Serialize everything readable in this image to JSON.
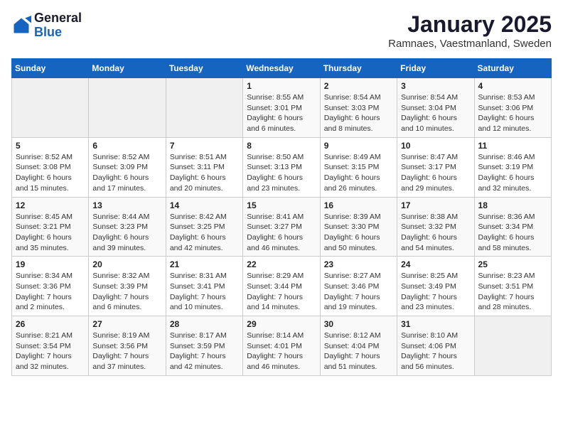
{
  "header": {
    "logo_general": "General",
    "logo_blue": "Blue",
    "month": "January 2025",
    "location": "Ramnaes, Vaestmanland, Sweden"
  },
  "days_of_week": [
    "Sunday",
    "Monday",
    "Tuesday",
    "Wednesday",
    "Thursday",
    "Friday",
    "Saturday"
  ],
  "weeks": [
    [
      {
        "day": "",
        "info": ""
      },
      {
        "day": "",
        "info": ""
      },
      {
        "day": "",
        "info": ""
      },
      {
        "day": "1",
        "info": "Sunrise: 8:55 AM\nSunset: 3:01 PM\nDaylight: 6 hours\nand 6 minutes."
      },
      {
        "day": "2",
        "info": "Sunrise: 8:54 AM\nSunset: 3:03 PM\nDaylight: 6 hours\nand 8 minutes."
      },
      {
        "day": "3",
        "info": "Sunrise: 8:54 AM\nSunset: 3:04 PM\nDaylight: 6 hours\nand 10 minutes."
      },
      {
        "day": "4",
        "info": "Sunrise: 8:53 AM\nSunset: 3:06 PM\nDaylight: 6 hours\nand 12 minutes."
      }
    ],
    [
      {
        "day": "5",
        "info": "Sunrise: 8:52 AM\nSunset: 3:08 PM\nDaylight: 6 hours\nand 15 minutes."
      },
      {
        "day": "6",
        "info": "Sunrise: 8:52 AM\nSunset: 3:09 PM\nDaylight: 6 hours\nand 17 minutes."
      },
      {
        "day": "7",
        "info": "Sunrise: 8:51 AM\nSunset: 3:11 PM\nDaylight: 6 hours\nand 20 minutes."
      },
      {
        "day": "8",
        "info": "Sunrise: 8:50 AM\nSunset: 3:13 PM\nDaylight: 6 hours\nand 23 minutes."
      },
      {
        "day": "9",
        "info": "Sunrise: 8:49 AM\nSunset: 3:15 PM\nDaylight: 6 hours\nand 26 minutes."
      },
      {
        "day": "10",
        "info": "Sunrise: 8:47 AM\nSunset: 3:17 PM\nDaylight: 6 hours\nand 29 minutes."
      },
      {
        "day": "11",
        "info": "Sunrise: 8:46 AM\nSunset: 3:19 PM\nDaylight: 6 hours\nand 32 minutes."
      }
    ],
    [
      {
        "day": "12",
        "info": "Sunrise: 8:45 AM\nSunset: 3:21 PM\nDaylight: 6 hours\nand 35 minutes."
      },
      {
        "day": "13",
        "info": "Sunrise: 8:44 AM\nSunset: 3:23 PM\nDaylight: 6 hours\nand 39 minutes."
      },
      {
        "day": "14",
        "info": "Sunrise: 8:42 AM\nSunset: 3:25 PM\nDaylight: 6 hours\nand 42 minutes."
      },
      {
        "day": "15",
        "info": "Sunrise: 8:41 AM\nSunset: 3:27 PM\nDaylight: 6 hours\nand 46 minutes."
      },
      {
        "day": "16",
        "info": "Sunrise: 8:39 AM\nSunset: 3:30 PM\nDaylight: 6 hours\nand 50 minutes."
      },
      {
        "day": "17",
        "info": "Sunrise: 8:38 AM\nSunset: 3:32 PM\nDaylight: 6 hours\nand 54 minutes."
      },
      {
        "day": "18",
        "info": "Sunrise: 8:36 AM\nSunset: 3:34 PM\nDaylight: 6 hours\nand 58 minutes."
      }
    ],
    [
      {
        "day": "19",
        "info": "Sunrise: 8:34 AM\nSunset: 3:36 PM\nDaylight: 7 hours\nand 2 minutes."
      },
      {
        "day": "20",
        "info": "Sunrise: 8:32 AM\nSunset: 3:39 PM\nDaylight: 7 hours\nand 6 minutes."
      },
      {
        "day": "21",
        "info": "Sunrise: 8:31 AM\nSunset: 3:41 PM\nDaylight: 7 hours\nand 10 minutes."
      },
      {
        "day": "22",
        "info": "Sunrise: 8:29 AM\nSunset: 3:44 PM\nDaylight: 7 hours\nand 14 minutes."
      },
      {
        "day": "23",
        "info": "Sunrise: 8:27 AM\nSunset: 3:46 PM\nDaylight: 7 hours\nand 19 minutes."
      },
      {
        "day": "24",
        "info": "Sunrise: 8:25 AM\nSunset: 3:49 PM\nDaylight: 7 hours\nand 23 minutes."
      },
      {
        "day": "25",
        "info": "Sunrise: 8:23 AM\nSunset: 3:51 PM\nDaylight: 7 hours\nand 28 minutes."
      }
    ],
    [
      {
        "day": "26",
        "info": "Sunrise: 8:21 AM\nSunset: 3:54 PM\nDaylight: 7 hours\nand 32 minutes."
      },
      {
        "day": "27",
        "info": "Sunrise: 8:19 AM\nSunset: 3:56 PM\nDaylight: 7 hours\nand 37 minutes."
      },
      {
        "day": "28",
        "info": "Sunrise: 8:17 AM\nSunset: 3:59 PM\nDaylight: 7 hours\nand 42 minutes."
      },
      {
        "day": "29",
        "info": "Sunrise: 8:14 AM\nSunset: 4:01 PM\nDaylight: 7 hours\nand 46 minutes."
      },
      {
        "day": "30",
        "info": "Sunrise: 8:12 AM\nSunset: 4:04 PM\nDaylight: 7 hours\nand 51 minutes."
      },
      {
        "day": "31",
        "info": "Sunrise: 8:10 AM\nSunset: 4:06 PM\nDaylight: 7 hours\nand 56 minutes."
      },
      {
        "day": "",
        "info": ""
      }
    ]
  ]
}
